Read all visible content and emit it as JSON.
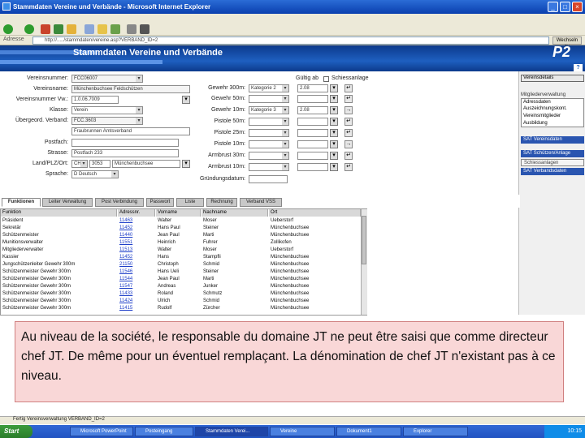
{
  "window": {
    "title": "Stammdaten Vereine und Verbände - Microsoft Internet Explorer",
    "minimize": "_",
    "maximize": "□",
    "close": "×"
  },
  "addressbar": {
    "label": "Adresse",
    "url": "http://...../stammdaten/vereine.asp?VERBAND_ID=2",
    "go": "Wechseln zu"
  },
  "app": {
    "title": "Stammdaten Vereine und Verbände",
    "logo": "P2",
    "help": "?"
  },
  "form": {
    "left": [
      {
        "label": "Vereinsnummer:",
        "value": "FCC06007"
      },
      {
        "label": "Vereinsname:",
        "value": "Münchenbuchsee Feldschützen"
      },
      {
        "label": "Vereinsnummer Vw.:",
        "value": "1.0.06.7009"
      },
      {
        "label": "Klasse:",
        "value": "Verein"
      },
      {
        "label": "Übergeord. Verband:",
        "value": "FCC.3603"
      },
      {
        "label": "",
        "value": "Fraubrunnen Amtsverband"
      },
      {
        "label": "Postfach:",
        "value": ""
      },
      {
        "label": "Strasse:",
        "value": "Postfach 233"
      },
      {
        "label": "Land/PLZ/Ort:",
        "value": "CH",
        "plz": "3053",
        "ort": "Münchenbuchsee"
      },
      {
        "label": "Sprache:",
        "value": "D Deutsch"
      }
    ],
    "right_header": "Gültig ab",
    "right_check": "Schiessanlage",
    "right": [
      {
        "label": "Gewehr 300m:",
        "value": "Kategorie 2",
        "date": "2.08"
      },
      {
        "label": "Gewehr 50m:",
        "value": "",
        "date": ""
      },
      {
        "label": "Gewehr 10m:",
        "value": "Kategorie 3",
        "date": "2.08"
      },
      {
        "label": "Pistole 50m:",
        "value": "",
        "date": ""
      },
      {
        "label": "Pistole 25m:",
        "value": "",
        "date": ""
      },
      {
        "label": "Pistole 10m:",
        "value": "",
        "date": ""
      },
      {
        "label": "Armbrust 30m:",
        "value": "",
        "date": ""
      },
      {
        "label": "Armbrust 10m:",
        "value": "",
        "date": ""
      }
    ],
    "founding_label": "Gründungsdatum:"
  },
  "side_panel": {
    "button_top": "Vereinsdetails",
    "section1": "Mitgliederverwaltung",
    "list1": [
      "Adressdaten",
      "Auszeichnungskont.",
      "Vereinsmitglieder",
      "Ausbildung"
    ],
    "buttons": [
      "SAT Vereinsdaten",
      "SAT Schützen/Anlage",
      "Schiessanlagen",
      "SAT Verbandsdaten"
    ]
  },
  "tabs": [
    "Funktionen",
    "Leiter Verwaltung",
    "Post Verbindung",
    "Passwort",
    "Liste",
    "Rechnung",
    "Verband VSS"
  ],
  "grid": {
    "headers": [
      "Funktion",
      "Adressnr.",
      "Vorname",
      "Nachname",
      "Ort"
    ],
    "rows": [
      [
        "Präsident",
        "11463",
        "Walter",
        "Moser",
        "Ueberstorf"
      ],
      [
        "Sekretär",
        "11452",
        "Hans Paul",
        "Steiner",
        "Münchenbuchsee"
      ],
      [
        "Schützenmeister",
        "11440",
        "Jean Paul",
        "Marti",
        "Münchenbuchsee"
      ],
      [
        "Munitionsverwalter",
        "11551",
        "Heinrich",
        "Fuhrer",
        "Zollikofen"
      ],
      [
        "Mitgliederverwalter",
        "11513",
        "Walter",
        "Moser",
        "Ueberstorf"
      ],
      [
        "Kassier",
        "11452",
        "Hans",
        "Stampfli",
        "Münchenbuchsee"
      ],
      [
        "Jungschützenleiter Gewehr 300m",
        "21150",
        "Christoph",
        "Schmid",
        "Münchenbuchsee"
      ],
      [
        "Schützenmeister Gewehr 300m",
        "11546",
        "Hans Ueli",
        "Steiner",
        "Münchenbuchsee"
      ],
      [
        "Schützenmeister Gewehr 300m",
        "11544",
        "Jean Paul",
        "Marti",
        "Münchenbuchsee"
      ],
      [
        "Schützenmeister Gewehr 300m",
        "11547",
        "Andreas",
        "Junker",
        "Münchenbuchsee"
      ],
      [
        "Schützenmeister Gewehr 300m",
        "11433",
        "Roland",
        "Schmutz",
        "Münchenbuchsee"
      ],
      [
        "Schützenmeister Gewehr 300m",
        "11424",
        "Ulrich",
        "Schmid",
        "Münchenbuchsee"
      ],
      [
        "Schützenmeister Gewehr 300m",
        "11415",
        "Rudolf",
        "Zürcher",
        "Münchenbuchsee"
      ]
    ]
  },
  "note": "Au niveau de la société, le responsable du domaine JT ne peut être saisi que comme directeur chef JT. De même pour un éventuel remplaçant. La dénomination de chef JT n'existant pas à ce niveau.",
  "status": "Fertig   Vereinsverwaltung VERBAND_ID=2",
  "taskbar": {
    "start": "Start",
    "items": [
      "Microsoft PowerPoint",
      "Posteingang",
      "Stammdaten Verei...",
      "Vereine",
      "Dokument1",
      "Explorer"
    ],
    "clock": "10:15"
  }
}
